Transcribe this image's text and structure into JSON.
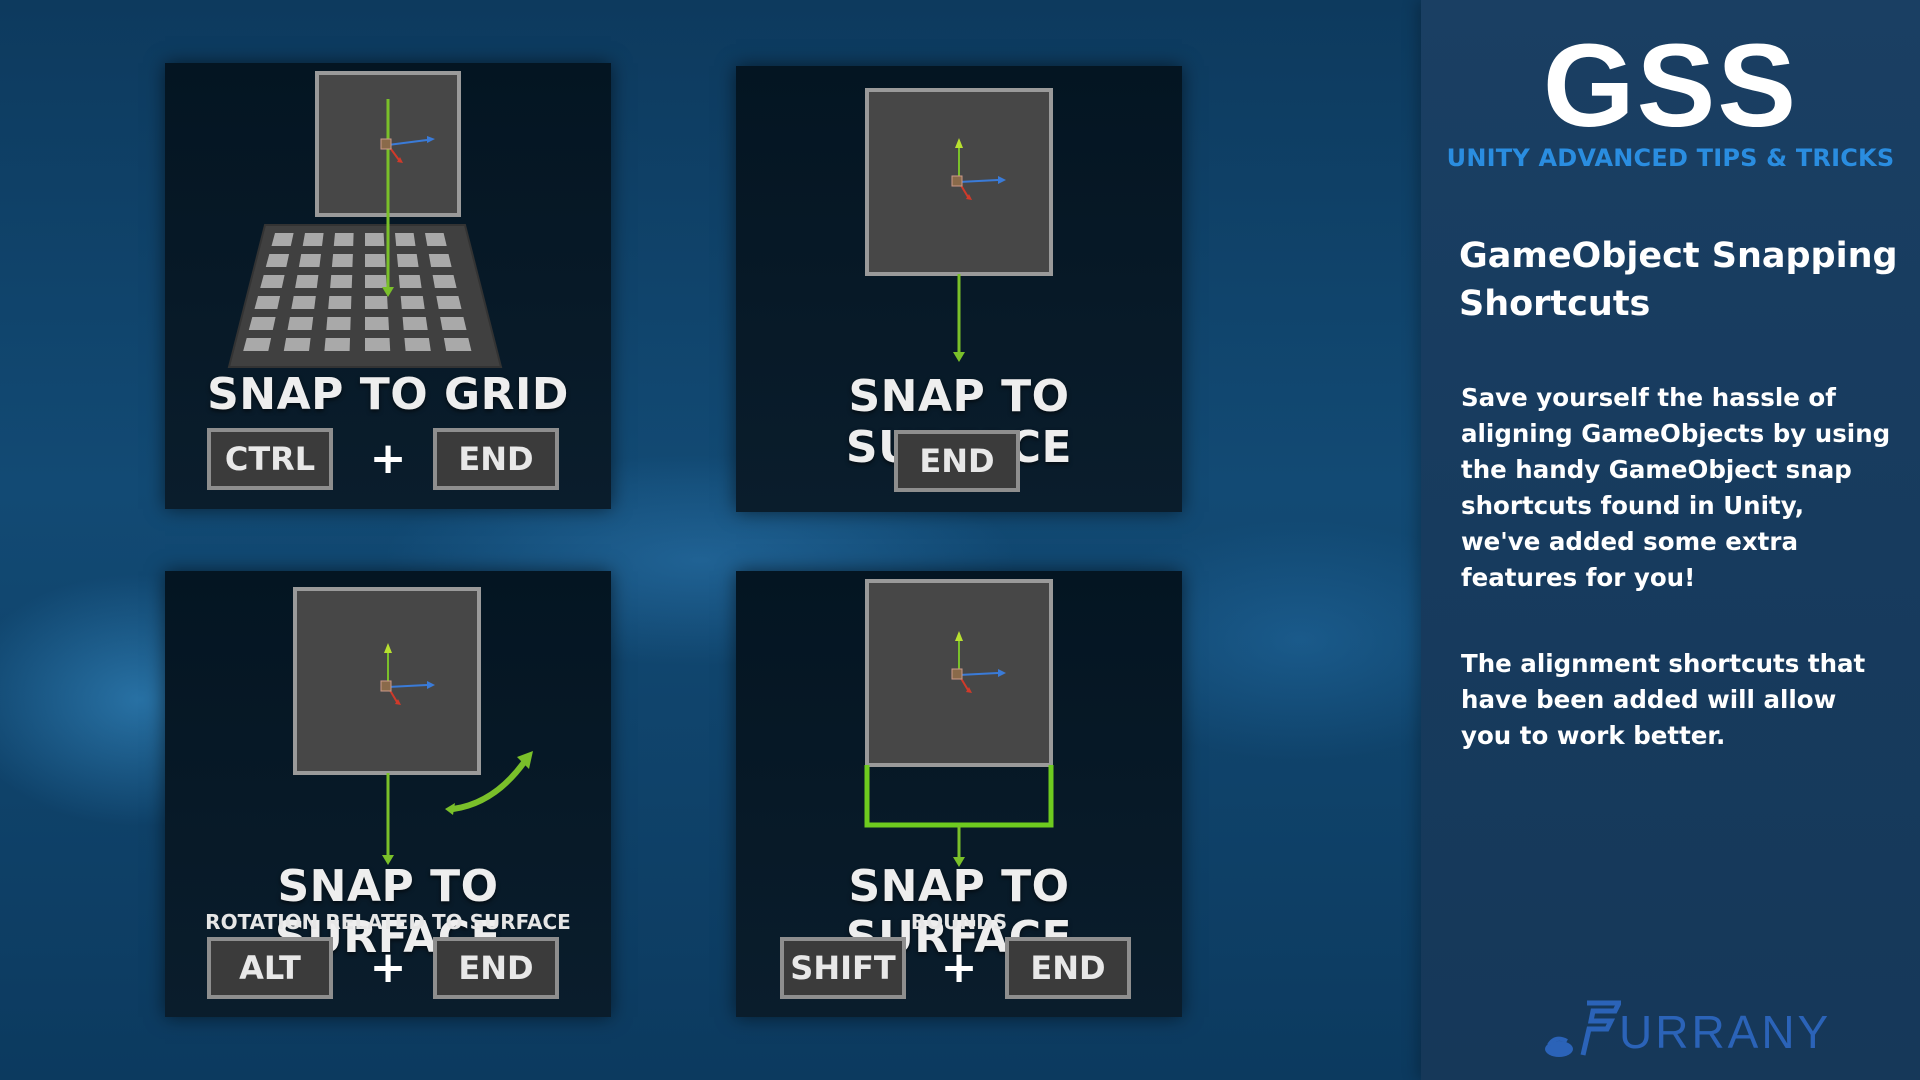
{
  "colors": {
    "background": "#124a74",
    "panel": "#041522",
    "sidebar": "#1a3f63",
    "key_fill": "#3b3b3b",
    "key_border": "#8e8e8e",
    "accent_blue": "#2a8de0",
    "bounds_green": "#6ecb1f",
    "brand_blue": "#2b63b8"
  },
  "cards": [
    {
      "title": "SNAP TO GRID",
      "subtitle": "",
      "keys": [
        "CTRL",
        "END"
      ],
      "plus": "+",
      "illustration": "cube-over-grid"
    },
    {
      "title": "SNAP TO SURFACE",
      "subtitle": "",
      "keys": [
        "END"
      ],
      "plus": "",
      "illustration": "cube-drop-arrow"
    },
    {
      "title": "SNAP TO SURFACE",
      "subtitle": "ROTATION RELATED TO SURFACE",
      "keys": [
        "ALT",
        "END"
      ],
      "plus": "+",
      "illustration": "cube-rotate-arrow"
    },
    {
      "title": "SNAP TO SURFACE",
      "subtitle": "BOUNDS",
      "keys": [
        "SHIFT",
        "END"
      ],
      "plus": "+",
      "illustration": "cube-bounds-box"
    }
  ],
  "sidebar": {
    "logo": "GSS",
    "tagline": "UNITY ADVANCED TIPS & TRICKS",
    "heading_line1": "GameObject Snapping",
    "heading_line2": "Shortcuts",
    "paragraph1": "Save yourself the hassle of aligning GameObjects by using the handy GameObject snap shortcuts found in Unity, we've added some extra features for you!",
    "paragraph2": "The alignment shortcuts that have been added will allow you to work better.",
    "brand": "URRANY"
  }
}
